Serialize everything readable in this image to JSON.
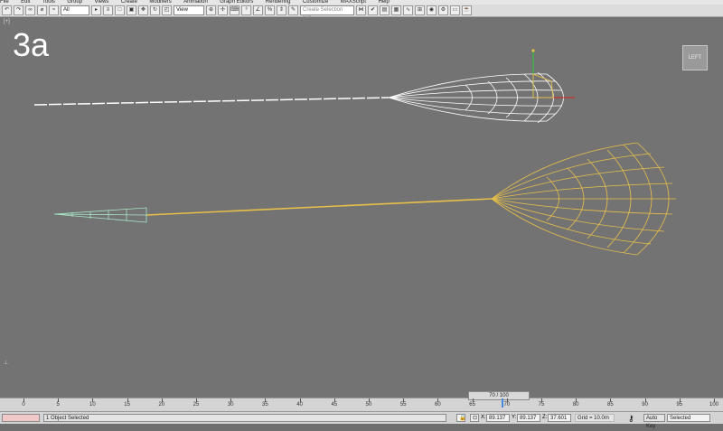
{
  "menu": [
    "File",
    "Edit",
    "Tools",
    "Group",
    "Views",
    "Create",
    "Modifiers",
    "Animation",
    "Graph Editors",
    "Rendering",
    "Customize",
    "MAXScript",
    "Help"
  ],
  "toolbar": {
    "filter_value": "All",
    "coord_value": "View",
    "selection_set_placeholder": "Create Selection Set"
  },
  "viewport": {
    "corner_label": "[+]",
    "overlay_label": "3a",
    "viewcube_label": "LEFT"
  },
  "timeline": {
    "frame_indicator": "70 / 100",
    "ticks": [
      "0",
      "5",
      "10",
      "15",
      "20",
      "25",
      "30",
      "35",
      "40",
      "45",
      "50",
      "55",
      "60",
      "65",
      "70",
      "75",
      "80",
      "85",
      "90",
      "95",
      "100"
    ]
  },
  "status": {
    "selection": "1 Object Selected",
    "x_label": "X:",
    "x_value": "89.137",
    "y_label": "Y:",
    "y_value": "89.137",
    "z_label": "Z:",
    "z_value": "37.601",
    "grid": "Grid = 10.0m",
    "auto_key": "Auto Key",
    "key_mode": "Selected"
  },
  "colors": {
    "viewport_bg": "#737373",
    "selected_wire": "#e8c04a",
    "white_wire": "#ffffff",
    "payload_wire": "#a8e6c8"
  }
}
